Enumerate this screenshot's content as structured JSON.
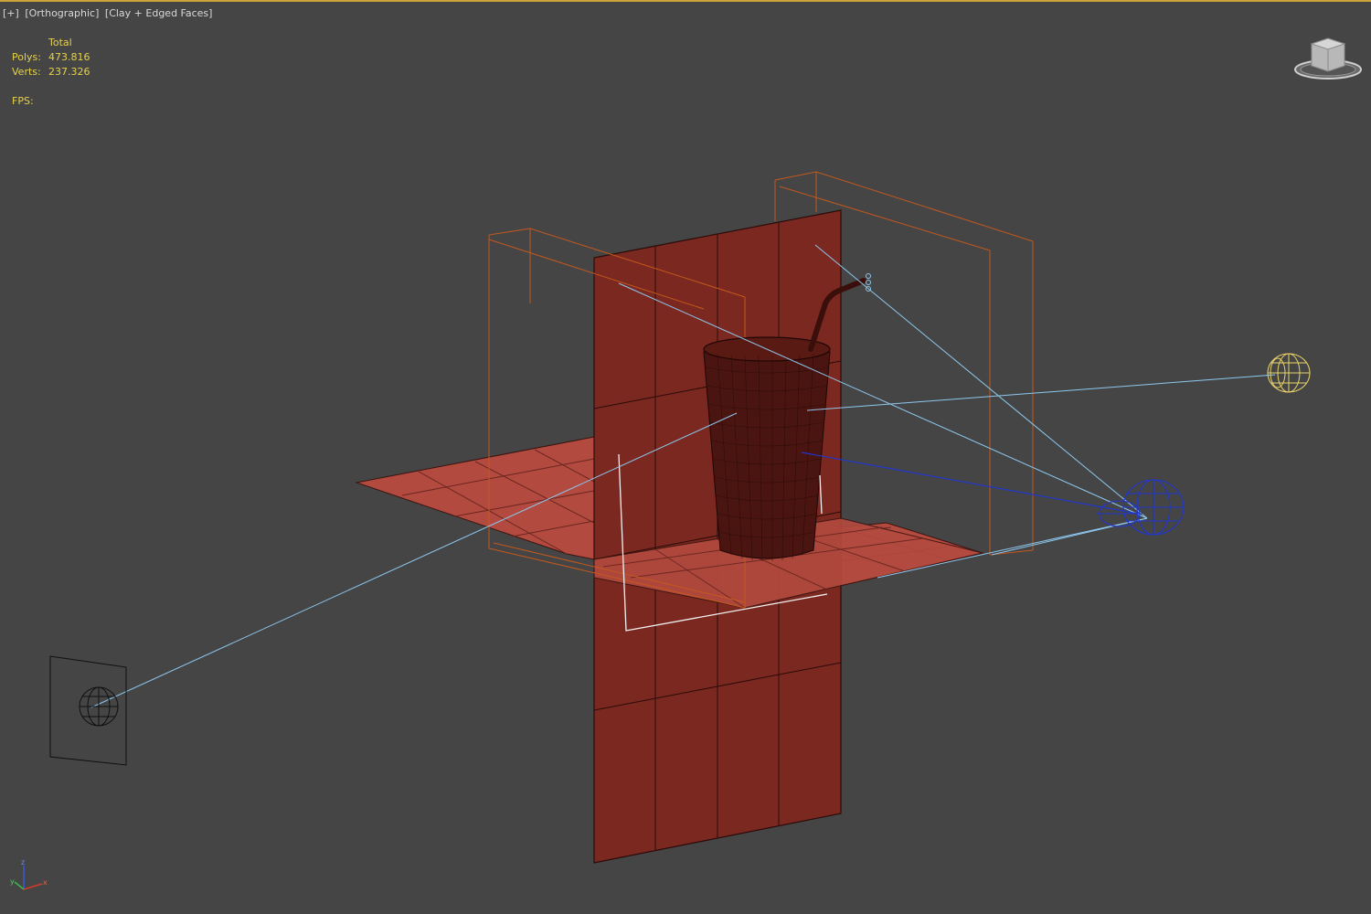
{
  "viewport": {
    "labels": [
      "[+]",
      "[Orthographic]",
      "[Clay + Edged Faces]"
    ]
  },
  "stats": {
    "header": "Total",
    "polys_label": "Polys:",
    "polys_value": "473.816",
    "verts_label": "Verts:",
    "verts_value": "237.326",
    "fps_label": "FPS:"
  },
  "colors": {
    "background": "#454545",
    "stats_text": "#e6d24a",
    "wall_fill": "#7a2820",
    "floor_fill": "#b24a3f",
    "light_lines": "#8ec8ef",
    "selected_light": "#2036d0",
    "bounding_box": "#c4581e",
    "yellow_light": "#e8d36a"
  },
  "icons": {
    "viewcube": "viewcube-icon",
    "axis": "axis-tripod-icon"
  }
}
